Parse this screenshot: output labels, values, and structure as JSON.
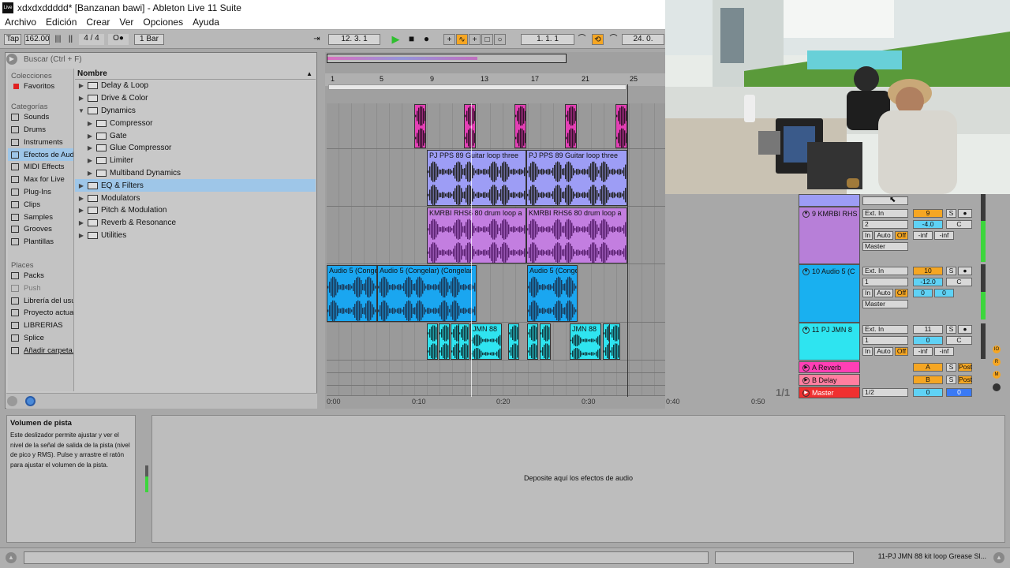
{
  "window": {
    "title": "xdxdxddddd*  [Banzanan bawi] - Ableton Live 11 Suite",
    "app_icon": "Live"
  },
  "menu": [
    "Archivo",
    "Edición",
    "Crear",
    "Ver",
    "Opciones",
    "Ayuda"
  ],
  "transport": {
    "tap": "Tap",
    "tempo": "162.00",
    "signature": "4 / 4",
    "metronome": "O●",
    "quantize": "1 Bar",
    "position": "12.  3.  1",
    "loop_start": "1.  1.  1",
    "loop_length": "24.  0."
  },
  "browser": {
    "search_placeholder": "Buscar (Ctrl + F)",
    "collections_header": "Colecciones",
    "favorites": "Favoritos",
    "categories_header": "Categorías",
    "categories": [
      "Sounds",
      "Drums",
      "Instruments",
      "Efectos de Aud",
      "MIDI Effects",
      "Max for Live",
      "Plug-Ins",
      "Clips",
      "Samples",
      "Grooves",
      "Plantillas"
    ],
    "places_header": "Places",
    "places": [
      "Packs",
      "Push",
      "Librería del usu",
      "Proyecto actua",
      "LIBRERIAS",
      "Splice",
      "Añadir carpeta..."
    ],
    "column_header": "Nombre",
    "items": [
      {
        "label": "Delay & Loop",
        "indent": 0,
        "open": false
      },
      {
        "label": "Drive & Color",
        "indent": 0,
        "open": false
      },
      {
        "label": "Dynamics",
        "indent": 0,
        "open": true
      },
      {
        "label": "Compressor",
        "indent": 1,
        "open": false
      },
      {
        "label": "Gate",
        "indent": 1,
        "open": false
      },
      {
        "label": "Glue Compressor",
        "indent": 1,
        "open": false
      },
      {
        "label": "Limiter",
        "indent": 1,
        "open": false
      },
      {
        "label": "Multiband Dynamics",
        "indent": 1,
        "open": false
      },
      {
        "label": "EQ & Filters",
        "indent": 0,
        "open": false,
        "selected": true
      },
      {
        "label": "Modulators",
        "indent": 0,
        "open": false
      },
      {
        "label": "Pitch & Modulation",
        "indent": 0,
        "open": false
      },
      {
        "label": "Reverb & Resonance",
        "indent": 0,
        "open": false
      },
      {
        "label": "Utilities",
        "indent": 0,
        "open": false
      }
    ]
  },
  "ruler": [
    "1",
    "5",
    "9",
    "13",
    "17",
    "21",
    "25"
  ],
  "timeline": [
    "0:00",
    "0:10",
    "0:20",
    "0:30",
    "0:40",
    "0:50"
  ],
  "page_counter": "1/1",
  "clips": {
    "guitar_a": "PJ  PPS  89  Guitar  loop  three",
    "guitar_b": "PJ  PPS  89  Guitar  loop  three",
    "drum_a": "KMRBI  RHS6  80  drum  loop  a",
    "drum_b": "KMRBI  RHS6  80  drum  loop  a",
    "audio5_a": "Audio 5 (Conge",
    "audio5_b": "Audio 5 (Congelar) (Congelar",
    "audio5_c": "Audio 5 (Conge",
    "jmn_a": "JMN  88",
    "jmn_b": "JMN  88"
  },
  "mixer": {
    "tracks": [
      {
        "name": "9 KMRBI  RHS",
        "input": "Ext. In",
        "channel": "2",
        "number": "9",
        "volume": "-4.0",
        "pan": "C",
        "out": "Master",
        "peak_l": "-inf",
        "peak_r": "-inf",
        "color": "#b77fd8"
      },
      {
        "name": "10 Audio 5 (C",
        "input": "Ext. In",
        "channel": "1",
        "number": "10",
        "volume": "-12.0",
        "pan": "C",
        "out": "Master",
        "peak_l": "0",
        "peak_r": "0",
        "color": "#19b0f0"
      },
      {
        "name": "11 PJ  JMN  8",
        "input": "Ext. In",
        "channel": "1",
        "number": "11",
        "volume": "0",
        "pan": "C",
        "out": "",
        "peak_l": "-inf",
        "peak_r": "-inf",
        "color": "#2ee4f0"
      }
    ],
    "returns": [
      {
        "name": "A Reverb",
        "letter": "A",
        "post": "Post",
        "color": "#ff3fb5"
      },
      {
        "name": "B Delay",
        "letter": "B",
        "post": "Post",
        "color": "#ff7ea0"
      },
      {
        "name": "Master",
        "letter": "1/2",
        "post": "",
        "color": "#f03030"
      }
    ],
    "in": "In",
    "auto": "Auto",
    "off": "Off",
    "solo": "S"
  },
  "info": {
    "title": "Volumen de pista",
    "text": "Este deslizador permite ajustar y ver el nivel de la señal de salida de la pista (nivel de pico y RMS). Pulse y arrastre el ratón para ajustar el volumen de la pista."
  },
  "device_hint": "Deposite aquí los efectos de audio",
  "status": "11-PJ  JMN  88  kit  loop  Grease  Sl..."
}
